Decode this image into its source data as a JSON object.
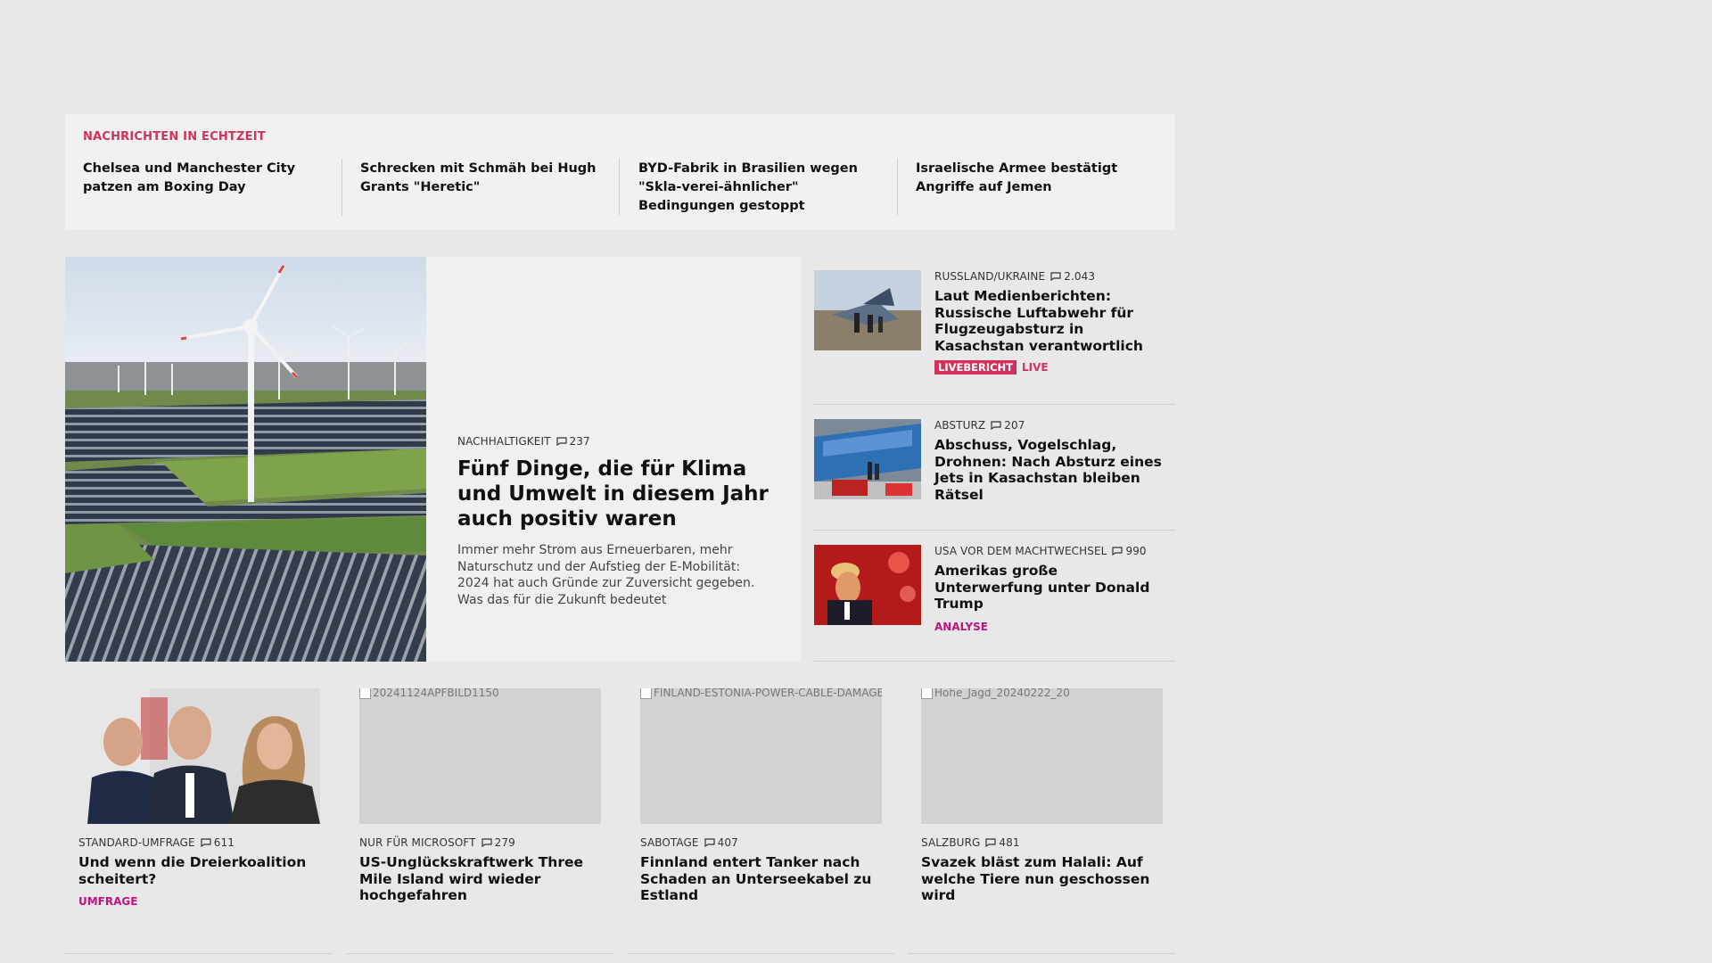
{
  "ticker": {
    "heading": "NACHRICHTEN IN ECHTZEIT",
    "items": [
      {
        "text": "Chelsea und Manchester City patzen am Boxing Day"
      },
      {
        "text": "Schrecken mit Schmäh bei Hugh Grants \"Heretic\""
      },
      {
        "text": "BYD-Fabrik in Brasilien wegen \"Skla-verei-ähnlicher\" Bedingungen gestoppt"
      },
      {
        "text": "Israelische Armee bestätigt Angriffe auf Jemen"
      }
    ]
  },
  "hero": {
    "kicker": "NACHHALTIGKEIT",
    "comments": "237",
    "title": "Fünf Dinge, die für Klima und Umwelt in diesem Jahr auch positiv waren",
    "description": "Immer mehr Strom aus Erneuerbaren, mehr Naturschutz und der Aufstieg der E-Mobilität: 2024 hat auch Gründe zur Zuversicht gegeben. Was das für die Zukunft bedeutet"
  },
  "side": [
    {
      "kicker": "RUSSLAND/UKRAINE",
      "comments": "2.043",
      "title": "Laut Medienberichten: Russische Luftabwehr für Flugzeugabsturz in Kasachstan verantwortlich",
      "badge": "LIVEBERICHT",
      "live": "LIVE"
    },
    {
      "kicker": "ABSTURZ",
      "comments": "207",
      "title": "Abschuss, Vogelschlag, Drohnen: Nach Absturz eines Jets in Kasachstan bleiben Rätsel"
    },
    {
      "kicker": "USA VOR DEM MACHTWECHSEL",
      "comments": "990",
      "title": "Amerikas große Unterwerfung unter Donald Trump",
      "tag": "ANALYSE"
    }
  ],
  "cards": [
    {
      "alt": "",
      "kicker": "STANDARD-UMFRAGE",
      "comments": "611",
      "title": "Und wenn die Dreierkoalition scheitert?",
      "tag": "UMFRAGE"
    },
    {
      "alt": "20241124APFBILD1150",
      "kicker": "NUR FÜR MICROSOFT",
      "comments": "279",
      "title": "US-Unglückskraftwerk Three Mile Island wird wieder hochgefahren"
    },
    {
      "alt": "FINLAND-ESTONIA-POWER-CABLE-DAMAGED",
      "kicker": "SABOTAGE",
      "comments": "407",
      "title": "Finnland entert Tanker nach Schaden an Unterseekabel zu Estland"
    },
    {
      "alt": "Hohe_Jagd_20240222_20",
      "kicker": "SALZBURG",
      "comments": "481",
      "title": "Svazek bläst zum Halali: Auf welche Tiere nun geschossen wird"
    }
  ],
  "colors": {
    "accent": "#d0325a",
    "analysis": "#c0137f",
    "background": "#e8e8e8",
    "panel": "#f1f1f1"
  },
  "icons": {
    "comment": "comment-icon"
  }
}
